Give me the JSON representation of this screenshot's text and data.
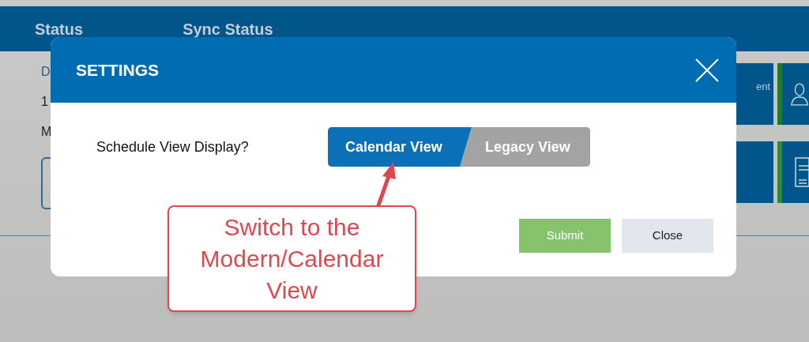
{
  "header": {
    "columns": [
      "Status",
      "Sync Status"
    ]
  },
  "background": {
    "fragments": [
      "D",
      "1",
      "M"
    ],
    "tiles": [
      {
        "kind": "label",
        "text": "ent"
      },
      {
        "kind": "plain"
      },
      {
        "kind": "person"
      },
      {
        "kind": "document"
      }
    ]
  },
  "modal": {
    "title": "SETTINGS",
    "question": "Schedule View Display?",
    "options": [
      {
        "label": "Calendar View",
        "selected": true
      },
      {
        "label": "Legacy View",
        "selected": false
      }
    ],
    "buttons": [
      {
        "label": "Submit",
        "kind": "primary"
      },
      {
        "label": "Close",
        "kind": "secondary"
      }
    ]
  },
  "callout": {
    "text": "Switch to the Modern/Calendar View"
  }
}
